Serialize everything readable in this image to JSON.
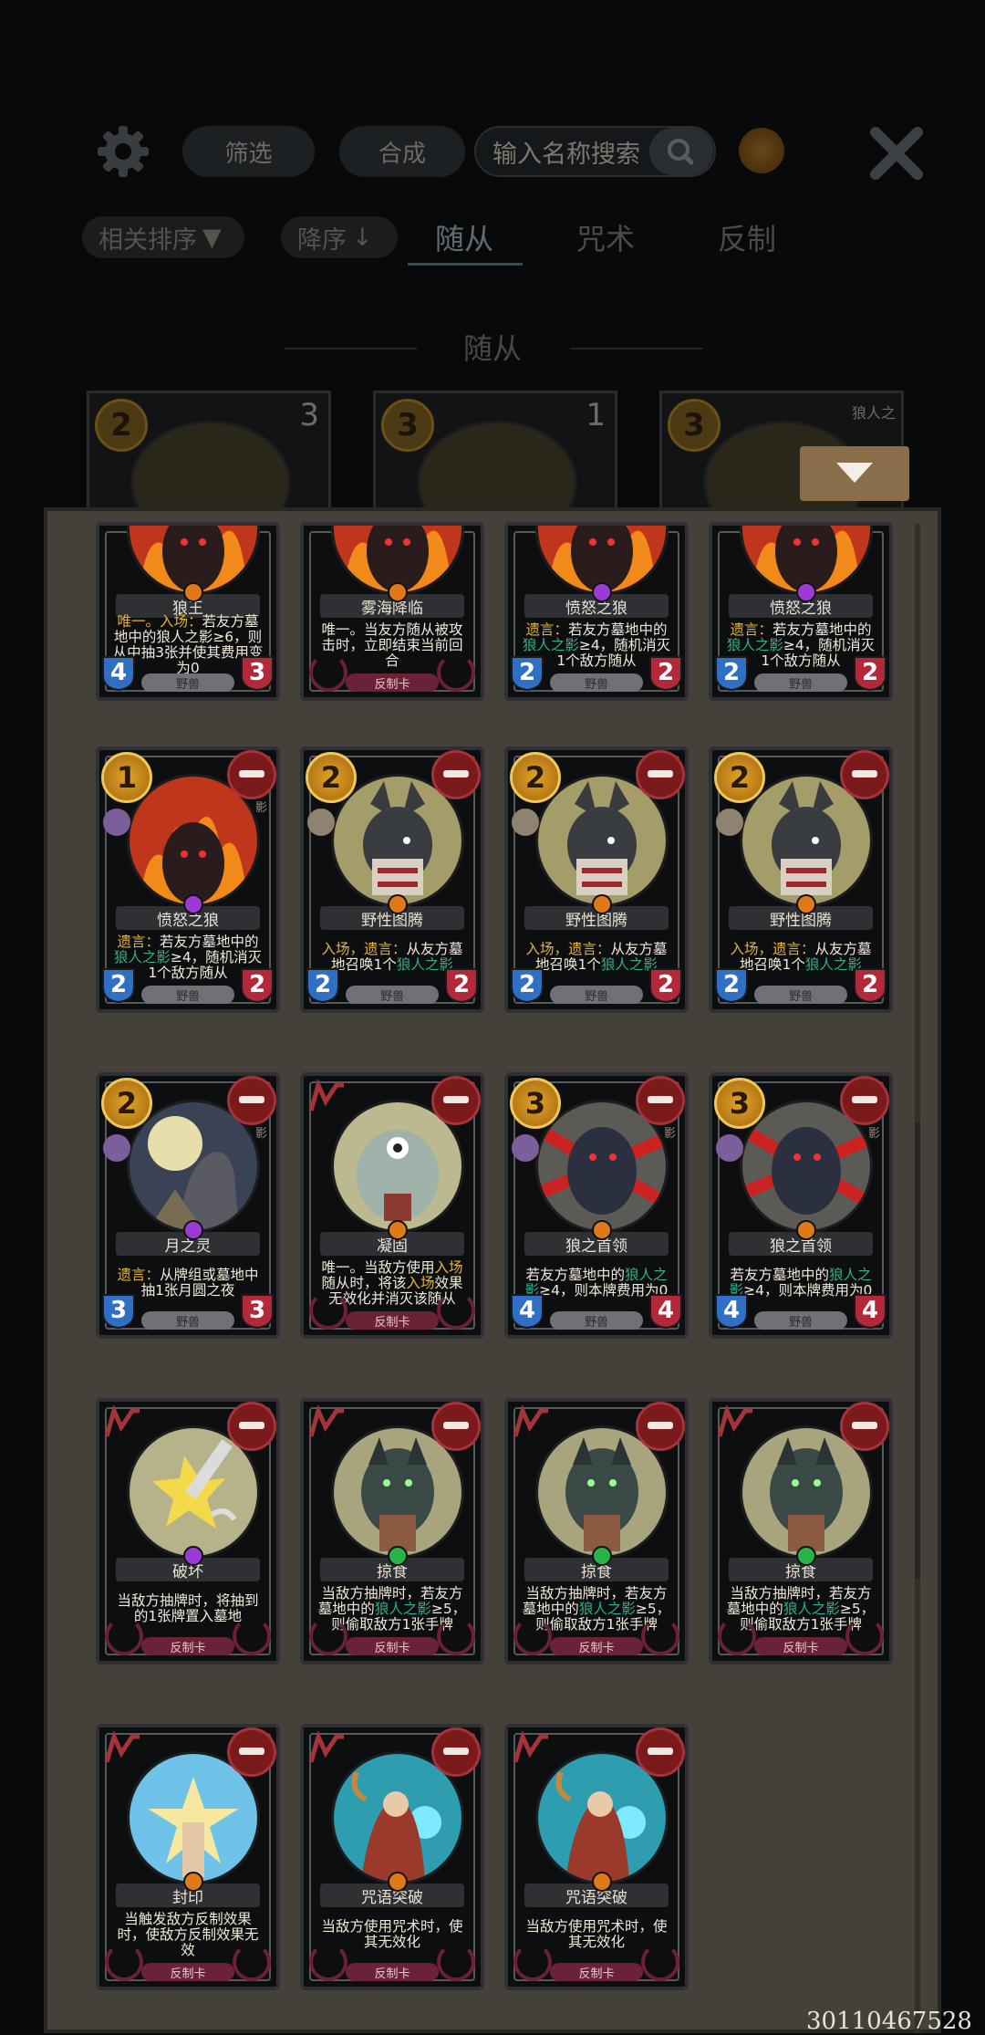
{
  "header": {
    "filter_label": "筛选",
    "compose_label": "合成",
    "search_placeholder": "输入名称搜索"
  },
  "sortbar": {
    "relevance_label": "相关排序",
    "order_label": "降序",
    "tabs": [
      "随从",
      "咒术",
      "反制"
    ],
    "active_tab": "随从"
  },
  "section_title": "随从",
  "top_cards": [
    {
      "cost": "2",
      "extra": "3"
    },
    {
      "cost": "3",
      "extra": "1"
    },
    {
      "cost": "3",
      "extra": "狼人之"
    }
  ],
  "cards": [
    {
      "name": "狼王",
      "cost": "",
      "desc": [
        [
          "y",
          "唯一。入场："
        ],
        [
          "w",
          "若友方墓地中的狼人之影≥6，则从中抽3张并使其费用变为0"
        ]
      ],
      "type": "野兽",
      "atk": "4",
      "hp": "3",
      "gem": "#e07a18",
      "partial": true
    },
    {
      "name": "雾海降临",
      "cost": "",
      "desc": [
        [
          "w",
          "唯一。当友方随从被攻击时，立即结束当前回合"
        ]
      ],
      "type": "反制卡",
      "atk": "",
      "hp": "",
      "gem": "#e07a18",
      "partial": true
    },
    {
      "name": "愤怒之狼",
      "cost": "",
      "desc": [
        [
          "y",
          "遗言："
        ],
        [
          "w",
          "若友方墓地中的"
        ],
        [
          "g",
          "狼人之影"
        ],
        [
          "w",
          "≥4，随机消灭1个敌方随从"
        ]
      ],
      "type": "野兽",
      "atk": "2",
      "hp": "2",
      "gem": "#9b3ad6",
      "partial": true
    },
    {
      "name": "愤怒之狼",
      "cost": "",
      "desc": [
        [
          "y",
          "遗言："
        ],
        [
          "w",
          "若友方墓地中的"
        ],
        [
          "g",
          "狼人之影"
        ],
        [
          "w",
          "≥4，随机消灭1个敌方随从"
        ]
      ],
      "type": "野兽",
      "atk": "2",
      "hp": "2",
      "gem": "#9b3ad6",
      "partial": true
    },
    {
      "name": "愤怒之狼",
      "cost": "1",
      "faction": "影",
      "tribe": "shadow",
      "desc": [
        [
          "y",
          "遗言："
        ],
        [
          "w",
          "若友方墓地中的"
        ],
        [
          "g",
          "狼人之影"
        ],
        [
          "w",
          "≥4，随机消灭1个敌方随从"
        ]
      ],
      "type": "野兽",
      "atk": "2",
      "hp": "2",
      "gem": "#9b3ad6",
      "art": "fire"
    },
    {
      "name": "野性图腾",
      "cost": "2",
      "tribe": "beast",
      "desc": [
        [
          "y",
          "入场，遗言："
        ],
        [
          "w",
          "从友方墓地召唤1个"
        ],
        [
          "g",
          "狼人之影"
        ]
      ],
      "type": "野兽",
      "atk": "2",
      "hp": "2",
      "gem": "#e07a18",
      "art": "totem"
    },
    {
      "name": "野性图腾",
      "cost": "2",
      "tribe": "beast",
      "desc": [
        [
          "y",
          "入场，遗言："
        ],
        [
          "w",
          "从友方墓地召唤1个"
        ],
        [
          "g",
          "狼人之影"
        ]
      ],
      "type": "野兽",
      "atk": "2",
      "hp": "2",
      "gem": "#e07a18",
      "art": "totem"
    },
    {
      "name": "野性图腾",
      "cost": "2",
      "tribe": "beast",
      "desc": [
        [
          "y",
          "入场，遗言："
        ],
        [
          "w",
          "从友方墓地召唤1个"
        ],
        [
          "g",
          "狼人之影"
        ]
      ],
      "type": "野兽",
      "atk": "2",
      "hp": "2",
      "gem": "#e07a18",
      "art": "totem"
    },
    {
      "name": "月之灵",
      "cost": "2",
      "faction": "影",
      "tribe": "shadow",
      "desc": [
        [
          "y",
          "遗言："
        ],
        [
          "w",
          "从牌组或墓地中抽1张月圆之夜"
        ]
      ],
      "type": "野兽",
      "atk": "3",
      "hp": "3",
      "gem": "#9b3ad6",
      "art": "moon"
    },
    {
      "name": "凝固",
      "cost": "",
      "counter": true,
      "desc": [
        [
          "w",
          "唯一。当敌方使用"
        ],
        [
          "y",
          "入场"
        ],
        [
          "w",
          "随从时，将该"
        ],
        [
          "y",
          "入场"
        ],
        [
          "w",
          "效果无效化并消灭该随从"
        ]
      ],
      "type": "反制卡",
      "atk": "",
      "hp": "",
      "gem": "#e07a18",
      "art": "ogre"
    },
    {
      "name": "狼之首领",
      "cost": "3",
      "faction": "影",
      "tribe": "shadow",
      "desc": [
        [
          "w",
          "若友方墓地中的"
        ],
        [
          "g",
          "狼人之影"
        ],
        [
          "w",
          "≥4，则本牌费用为0"
        ]
      ],
      "type": "野兽",
      "atk": "4",
      "hp": "4",
      "gem": "#e07a18",
      "art": "chief"
    },
    {
      "name": "狼之首领",
      "cost": "3",
      "faction": "影",
      "tribe": "shadow",
      "desc": [
        [
          "w",
          "若友方墓地中的"
        ],
        [
          "g",
          "狼人之影"
        ],
        [
          "w",
          "≥4，则本牌费用为0"
        ]
      ],
      "type": "野兽",
      "atk": "4",
      "hp": "4",
      "gem": "#e07a18",
      "art": "chief"
    },
    {
      "name": "破坏",
      "cost": "",
      "counter": true,
      "desc": [
        [
          "w",
          "当敌方抽牌时，将抽到的1张牌置入墓地"
        ]
      ],
      "type": "反制卡",
      "atk": "",
      "hp": "",
      "gem": "#9b3ad6",
      "art": "break"
    },
    {
      "name": "掠食",
      "cost": "",
      "counter": true,
      "desc": [
        [
          "w",
          "当敌方抽牌时，若友方墓地中的"
        ],
        [
          "g",
          "狼人之影"
        ],
        [
          "w",
          "≥5，则偷取敌方1张手牌"
        ]
      ],
      "type": "反制卡",
      "atk": "",
      "hp": "",
      "gem": "#2bb34a",
      "art": "prey"
    },
    {
      "name": "掠食",
      "cost": "",
      "counter": true,
      "desc": [
        [
          "w",
          "当敌方抽牌时，若友方墓地中的"
        ],
        [
          "g",
          "狼人之影"
        ],
        [
          "w",
          "≥5，则偷取敌方1张手牌"
        ]
      ],
      "type": "反制卡",
      "atk": "",
      "hp": "",
      "gem": "#2bb34a",
      "art": "prey"
    },
    {
      "name": "掠食",
      "cost": "",
      "counter": true,
      "desc": [
        [
          "w",
          "当敌方抽牌时，若友方墓地中的"
        ],
        [
          "g",
          "狼人之影"
        ],
        [
          "w",
          "≥5，则偷取敌方1张手牌"
        ]
      ],
      "type": "反制卡",
      "atk": "",
      "hp": "",
      "gem": "#2bb34a",
      "art": "prey"
    },
    {
      "name": "封印",
      "cost": "",
      "counter": true,
      "desc": [
        [
          "w",
          "当触发敌方反制效果时，使敌方反制效果无效"
        ]
      ],
      "type": "反制卡",
      "atk": "",
      "hp": "",
      "gem": "#e07a18",
      "art": "seal"
    },
    {
      "name": "咒语突破",
      "cost": "",
      "counter": true,
      "desc": [
        [
          "w",
          "当敌方使用咒术时，使其无效化"
        ]
      ],
      "type": "反制卡",
      "atk": "",
      "hp": "",
      "gem": "#e07a18",
      "art": "mage"
    },
    {
      "name": "咒语突破",
      "cost": "",
      "counter": true,
      "desc": [
        [
          "w",
          "当敌方使用咒术时，使其无效化"
        ]
      ],
      "type": "反制卡",
      "atk": "",
      "hp": "",
      "gem": "#e07a18",
      "art": "mage"
    }
  ],
  "footer_id": "30110467528",
  "colors": {
    "accent": "#e6b23a",
    "keyword": "#2fb08a",
    "counter": "#6a2236"
  }
}
